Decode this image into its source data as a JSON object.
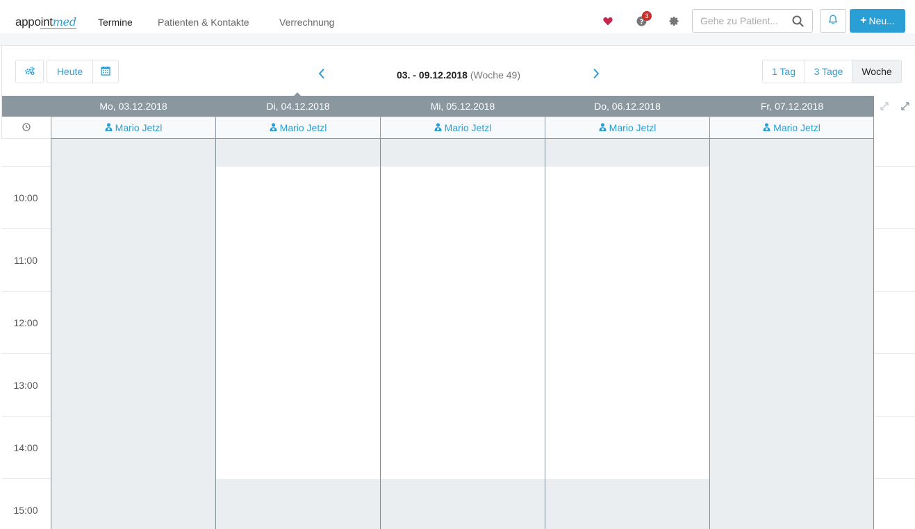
{
  "brand": {
    "name_part1": "appoint",
    "name_part2": "med"
  },
  "nav": {
    "termine": "Termine",
    "patienten": "Patienten & Kontakte",
    "verrechnung": "Verrechnung"
  },
  "header": {
    "help_badge_count": "3",
    "search_placeholder": "Gehe zu Patient...",
    "new_button": "Neu...",
    "new_button_icon": "+"
  },
  "toolbar": {
    "today": "Heute",
    "range_bold": "03. - 09.12.2018",
    "range_week": "(Woche 49)",
    "views": [
      "1 Tag",
      "3 Tage",
      "Woche"
    ],
    "active_view": "Woche"
  },
  "calendar": {
    "days": [
      {
        "label": "Mo, 03.12.2018",
        "resource": "Mario Jetzl",
        "open_from": null,
        "open_to": null
      },
      {
        "label": "Di, 04.12.2018",
        "resource": "Mario Jetzl",
        "open_from": "09:30",
        "open_to": "15:00"
      },
      {
        "label": "Mi, 05.12.2018",
        "resource": "Mario Jetzl",
        "open_from": "09:30",
        "open_to": "15:00"
      },
      {
        "label": "Do, 06.12.2018",
        "resource": "Mario Jetzl",
        "open_from": "09:30",
        "open_to": "15:00"
      },
      {
        "label": "Fr, 07.12.2018",
        "resource": "Mario Jetzl",
        "open_from": null,
        "open_to": null
      }
    ],
    "hours": [
      "10:00",
      "11:00",
      "12:00",
      "13:00",
      "14:00",
      "15:00"
    ]
  },
  "colors": {
    "accent": "#2a9fd6",
    "header_bar": "#8a979f",
    "closed_slot": "#eaeef0",
    "heart": "#c7254e",
    "badge": "#c9302c"
  }
}
